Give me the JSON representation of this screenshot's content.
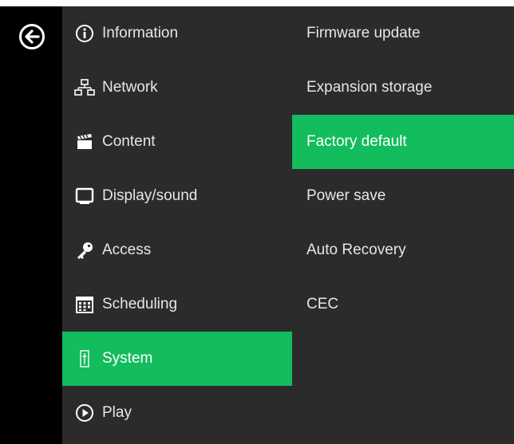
{
  "main_menu": {
    "items": [
      {
        "label": "Information",
        "icon": "info-icon"
      },
      {
        "label": "Network",
        "icon": "network-icon"
      },
      {
        "label": "Content",
        "icon": "clapperboard-icon"
      },
      {
        "label": "Display/sound",
        "icon": "monitor-icon"
      },
      {
        "label": "Access",
        "icon": "key-icon"
      },
      {
        "label": "Scheduling",
        "icon": "calendar-icon"
      },
      {
        "label": "System",
        "icon": "system-icon",
        "active": true
      },
      {
        "label": "Play",
        "icon": "play-icon"
      }
    ]
  },
  "sub_menu": {
    "items": [
      {
        "label": "Firmware update"
      },
      {
        "label": "Expansion storage"
      },
      {
        "label": "Factory default",
        "active": true
      },
      {
        "label": "Power save"
      },
      {
        "label": "Auto Recovery"
      },
      {
        "label": "CEC"
      }
    ]
  },
  "colors": {
    "accent": "#13bc5d",
    "panel": "#2b2b2b",
    "back_column": "#000000",
    "text": "#e6e6e6"
  }
}
